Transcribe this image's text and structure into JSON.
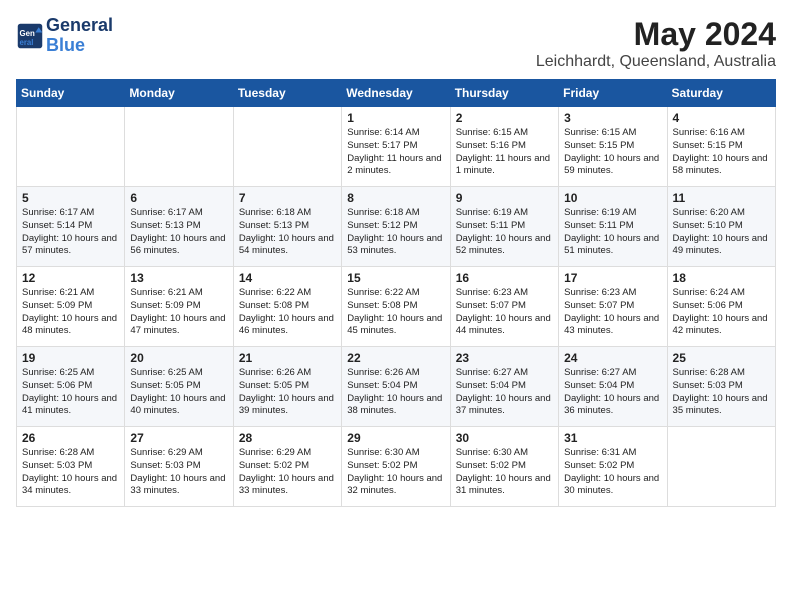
{
  "logo": {
    "line1": "General",
    "line2": "Blue"
  },
  "title": "May 2024",
  "location": "Leichhardt, Queensland, Australia",
  "weekdays": [
    "Sunday",
    "Monday",
    "Tuesday",
    "Wednesday",
    "Thursday",
    "Friday",
    "Saturday"
  ],
  "weeks": [
    [
      {
        "day": "",
        "sunrise": "",
        "sunset": "",
        "daylight": ""
      },
      {
        "day": "",
        "sunrise": "",
        "sunset": "",
        "daylight": ""
      },
      {
        "day": "",
        "sunrise": "",
        "sunset": "",
        "daylight": ""
      },
      {
        "day": "1",
        "sunrise": "Sunrise: 6:14 AM",
        "sunset": "Sunset: 5:17 PM",
        "daylight": "Daylight: 11 hours and 2 minutes."
      },
      {
        "day": "2",
        "sunrise": "Sunrise: 6:15 AM",
        "sunset": "Sunset: 5:16 PM",
        "daylight": "Daylight: 11 hours and 1 minute."
      },
      {
        "day": "3",
        "sunrise": "Sunrise: 6:15 AM",
        "sunset": "Sunset: 5:15 PM",
        "daylight": "Daylight: 10 hours and 59 minutes."
      },
      {
        "day": "4",
        "sunrise": "Sunrise: 6:16 AM",
        "sunset": "Sunset: 5:15 PM",
        "daylight": "Daylight: 10 hours and 58 minutes."
      }
    ],
    [
      {
        "day": "5",
        "sunrise": "Sunrise: 6:17 AM",
        "sunset": "Sunset: 5:14 PM",
        "daylight": "Daylight: 10 hours and 57 minutes."
      },
      {
        "day": "6",
        "sunrise": "Sunrise: 6:17 AM",
        "sunset": "Sunset: 5:13 PM",
        "daylight": "Daylight: 10 hours and 56 minutes."
      },
      {
        "day": "7",
        "sunrise": "Sunrise: 6:18 AM",
        "sunset": "Sunset: 5:13 PM",
        "daylight": "Daylight: 10 hours and 54 minutes."
      },
      {
        "day": "8",
        "sunrise": "Sunrise: 6:18 AM",
        "sunset": "Sunset: 5:12 PM",
        "daylight": "Daylight: 10 hours and 53 minutes."
      },
      {
        "day": "9",
        "sunrise": "Sunrise: 6:19 AM",
        "sunset": "Sunset: 5:11 PM",
        "daylight": "Daylight: 10 hours and 52 minutes."
      },
      {
        "day": "10",
        "sunrise": "Sunrise: 6:19 AM",
        "sunset": "Sunset: 5:11 PM",
        "daylight": "Daylight: 10 hours and 51 minutes."
      },
      {
        "day": "11",
        "sunrise": "Sunrise: 6:20 AM",
        "sunset": "Sunset: 5:10 PM",
        "daylight": "Daylight: 10 hours and 49 minutes."
      }
    ],
    [
      {
        "day": "12",
        "sunrise": "Sunrise: 6:21 AM",
        "sunset": "Sunset: 5:09 PM",
        "daylight": "Daylight: 10 hours and 48 minutes."
      },
      {
        "day": "13",
        "sunrise": "Sunrise: 6:21 AM",
        "sunset": "Sunset: 5:09 PM",
        "daylight": "Daylight: 10 hours and 47 minutes."
      },
      {
        "day": "14",
        "sunrise": "Sunrise: 6:22 AM",
        "sunset": "Sunset: 5:08 PM",
        "daylight": "Daylight: 10 hours and 46 minutes."
      },
      {
        "day": "15",
        "sunrise": "Sunrise: 6:22 AM",
        "sunset": "Sunset: 5:08 PM",
        "daylight": "Daylight: 10 hours and 45 minutes."
      },
      {
        "day": "16",
        "sunrise": "Sunrise: 6:23 AM",
        "sunset": "Sunset: 5:07 PM",
        "daylight": "Daylight: 10 hours and 44 minutes."
      },
      {
        "day": "17",
        "sunrise": "Sunrise: 6:23 AM",
        "sunset": "Sunset: 5:07 PM",
        "daylight": "Daylight: 10 hours and 43 minutes."
      },
      {
        "day": "18",
        "sunrise": "Sunrise: 6:24 AM",
        "sunset": "Sunset: 5:06 PM",
        "daylight": "Daylight: 10 hours and 42 minutes."
      }
    ],
    [
      {
        "day": "19",
        "sunrise": "Sunrise: 6:25 AM",
        "sunset": "Sunset: 5:06 PM",
        "daylight": "Daylight: 10 hours and 41 minutes."
      },
      {
        "day": "20",
        "sunrise": "Sunrise: 6:25 AM",
        "sunset": "Sunset: 5:05 PM",
        "daylight": "Daylight: 10 hours and 40 minutes."
      },
      {
        "day": "21",
        "sunrise": "Sunrise: 6:26 AM",
        "sunset": "Sunset: 5:05 PM",
        "daylight": "Daylight: 10 hours and 39 minutes."
      },
      {
        "day": "22",
        "sunrise": "Sunrise: 6:26 AM",
        "sunset": "Sunset: 5:04 PM",
        "daylight": "Daylight: 10 hours and 38 minutes."
      },
      {
        "day": "23",
        "sunrise": "Sunrise: 6:27 AM",
        "sunset": "Sunset: 5:04 PM",
        "daylight": "Daylight: 10 hours and 37 minutes."
      },
      {
        "day": "24",
        "sunrise": "Sunrise: 6:27 AM",
        "sunset": "Sunset: 5:04 PM",
        "daylight": "Daylight: 10 hours and 36 minutes."
      },
      {
        "day": "25",
        "sunrise": "Sunrise: 6:28 AM",
        "sunset": "Sunset: 5:03 PM",
        "daylight": "Daylight: 10 hours and 35 minutes."
      }
    ],
    [
      {
        "day": "26",
        "sunrise": "Sunrise: 6:28 AM",
        "sunset": "Sunset: 5:03 PM",
        "daylight": "Daylight: 10 hours and 34 minutes."
      },
      {
        "day": "27",
        "sunrise": "Sunrise: 6:29 AM",
        "sunset": "Sunset: 5:03 PM",
        "daylight": "Daylight: 10 hours and 33 minutes."
      },
      {
        "day": "28",
        "sunrise": "Sunrise: 6:29 AM",
        "sunset": "Sunset: 5:02 PM",
        "daylight": "Daylight: 10 hours and 33 minutes."
      },
      {
        "day": "29",
        "sunrise": "Sunrise: 6:30 AM",
        "sunset": "Sunset: 5:02 PM",
        "daylight": "Daylight: 10 hours and 32 minutes."
      },
      {
        "day": "30",
        "sunrise": "Sunrise: 6:30 AM",
        "sunset": "Sunset: 5:02 PM",
        "daylight": "Daylight: 10 hours and 31 minutes."
      },
      {
        "day": "31",
        "sunrise": "Sunrise: 6:31 AM",
        "sunset": "Sunset: 5:02 PM",
        "daylight": "Daylight: 10 hours and 30 minutes."
      },
      {
        "day": "",
        "sunrise": "",
        "sunset": "",
        "daylight": ""
      }
    ]
  ]
}
